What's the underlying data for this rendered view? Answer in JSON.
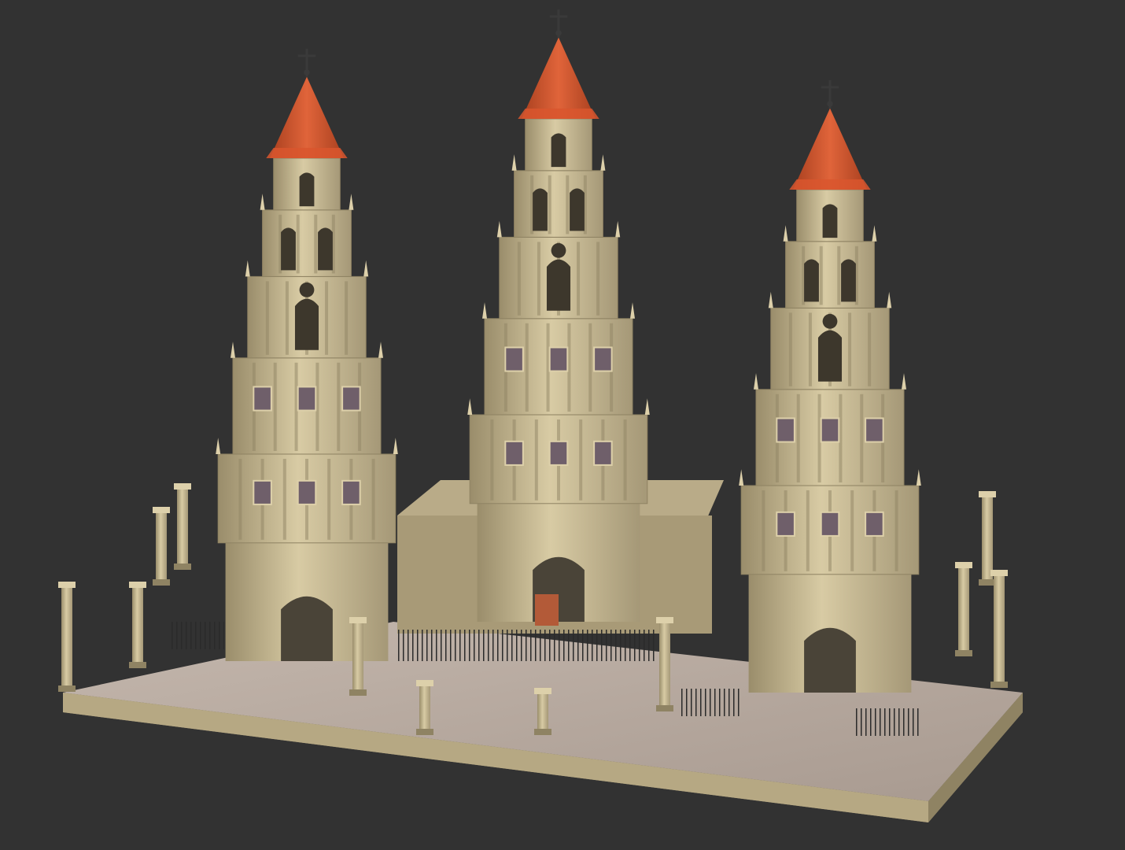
{
  "scene": {
    "subject": "three-bell-tower-baroque-cathedral-model",
    "tower_count": 3,
    "colors": {
      "background": "#323232",
      "stone": "#cbbb92",
      "stone_light": "#ddd0aa",
      "stone_shadow": "#8f8363",
      "roof_tile": "#d9562e",
      "roof_dark": "#9e3a1f",
      "plaza_paving": "#b7aaa0",
      "window_grid": "#6f5f6a",
      "iron_fence": "#2b2b2b",
      "door": "#b35a38"
    }
  }
}
